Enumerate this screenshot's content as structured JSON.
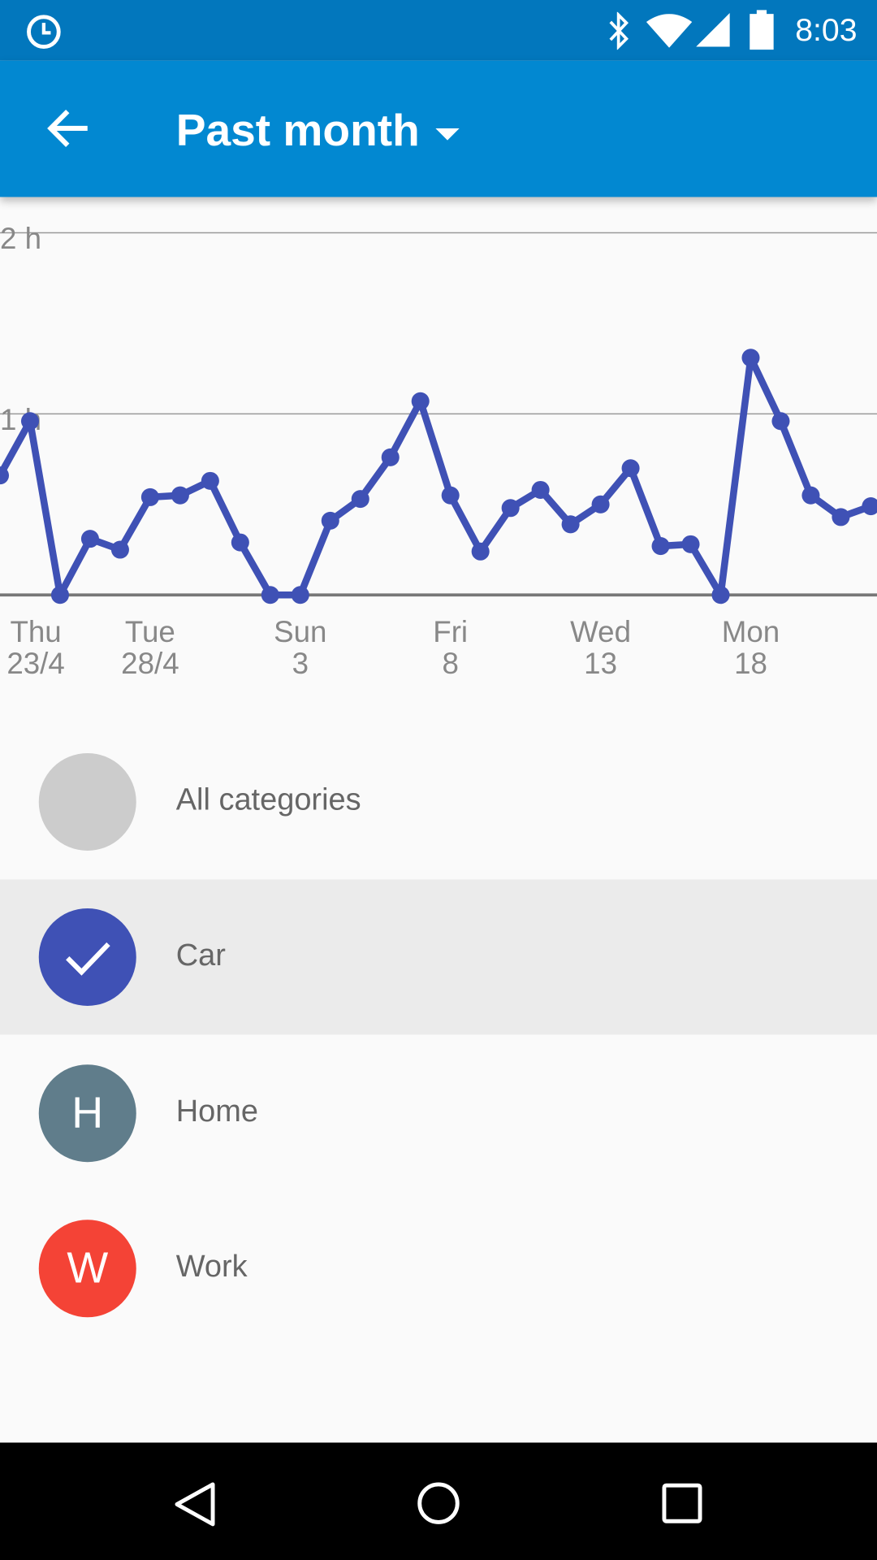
{
  "status_bar": {
    "time": "8:03",
    "icons": [
      "alarm-icon",
      "bluetooth-icon",
      "wifi-icon",
      "cell-signal-icon",
      "battery-icon"
    ]
  },
  "app_bar": {
    "title": "Past month",
    "back_icon": "arrow-back-icon",
    "dropdown_icon": "dropdown-arrow-icon"
  },
  "chart_data": {
    "type": "line",
    "y_ticks": [
      "2 h",
      "1 h"
    ],
    "ylim": [
      0,
      2
    ],
    "x_ticks": [
      {
        "line1": "Thu",
        "line2": "23/4",
        "day": 0
      },
      {
        "line1": "Tue",
        "line2": "28/4",
        "day": 5
      },
      {
        "line1": "Sun",
        "line2": "3",
        "day": 10
      },
      {
        "line1": "Fri",
        "line2": "8",
        "day": 15
      },
      {
        "line1": "Wed",
        "line2": "13",
        "day": 20
      },
      {
        "line1": "Mon",
        "line2": "18",
        "day": 25
      }
    ],
    "values_hours": [
      0.66,
      0.96,
      0,
      0.31,
      0.25,
      0.54,
      0.55,
      0.63,
      0.29,
      0,
      0,
      0.41,
      0.53,
      0.76,
      1.07,
      0.55,
      0.24,
      0.48,
      0.58,
      0.39,
      0.5,
      0.7,
      0.27,
      0.28,
      0,
      1.31,
      0.96,
      0.55,
      0.43,
      0.49
    ],
    "color": "#3f51b5",
    "grid": true
  },
  "categories": [
    {
      "label": "All categories",
      "initial": "",
      "color": "#cccccc",
      "selected": false
    },
    {
      "label": "Car",
      "initial": "",
      "color": "#3f51b5",
      "selected": true
    },
    {
      "label": "Home",
      "initial": "H",
      "color": "#607d8b",
      "selected": false
    },
    {
      "label": "Work",
      "initial": "W",
      "color": "#f44336",
      "selected": false
    }
  ]
}
